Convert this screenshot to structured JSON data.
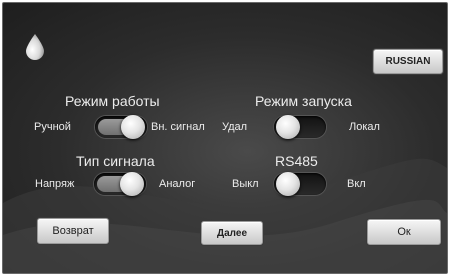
{
  "buttons": {
    "language": "RUSSIAN",
    "back": "Возврат",
    "next": "Далее",
    "ok": "Ок"
  },
  "settings": {
    "work_mode": {
      "title": "Режим работы",
      "left_option": "Ручной",
      "right_option": "Вн. сигнал",
      "selected": "right"
    },
    "start_mode": {
      "title": "Режим запуска",
      "left_option": "Удал",
      "right_option": "Локал",
      "selected": "left"
    },
    "signal_type": {
      "title": "Тип сигнала",
      "left_option": "Напряж",
      "right_option": "Аналог",
      "selected": "right"
    },
    "rs485": {
      "title": "RS485",
      "left_option": "Выкл",
      "right_option": "Вкл",
      "selected": "left"
    }
  },
  "icons": {
    "logo": "water-drop-icon"
  }
}
